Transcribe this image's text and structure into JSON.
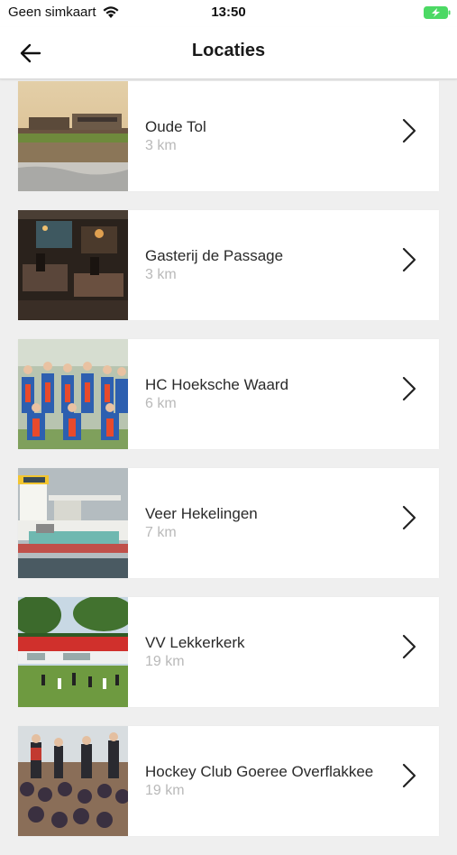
{
  "status_bar": {
    "carrier": "Geen simkaart",
    "time": "13:50",
    "battery_color": "#4cd964"
  },
  "header": {
    "title": "Locaties"
  },
  "locations": [
    {
      "name": "Oude Tol",
      "distance": "3 km",
      "image_icon": "beach-restaurant-photo"
    },
    {
      "name": "Gasterij de Passage",
      "distance": "3 km",
      "image_icon": "restaurant-interior-photo"
    },
    {
      "name": "HC Hoeksche Waard",
      "distance": "6 km",
      "image_icon": "hockey-team-photo"
    },
    {
      "name": "Veer Hekelingen",
      "distance": "7 km",
      "image_icon": "ferry-photo"
    },
    {
      "name": "VV Lekkerkerk",
      "distance": "19 km",
      "image_icon": "football-club-photo"
    },
    {
      "name": "Hockey Club Goeree Overflakkee",
      "distance": "19 km",
      "image_icon": "hockey-club-crowd-photo"
    }
  ]
}
